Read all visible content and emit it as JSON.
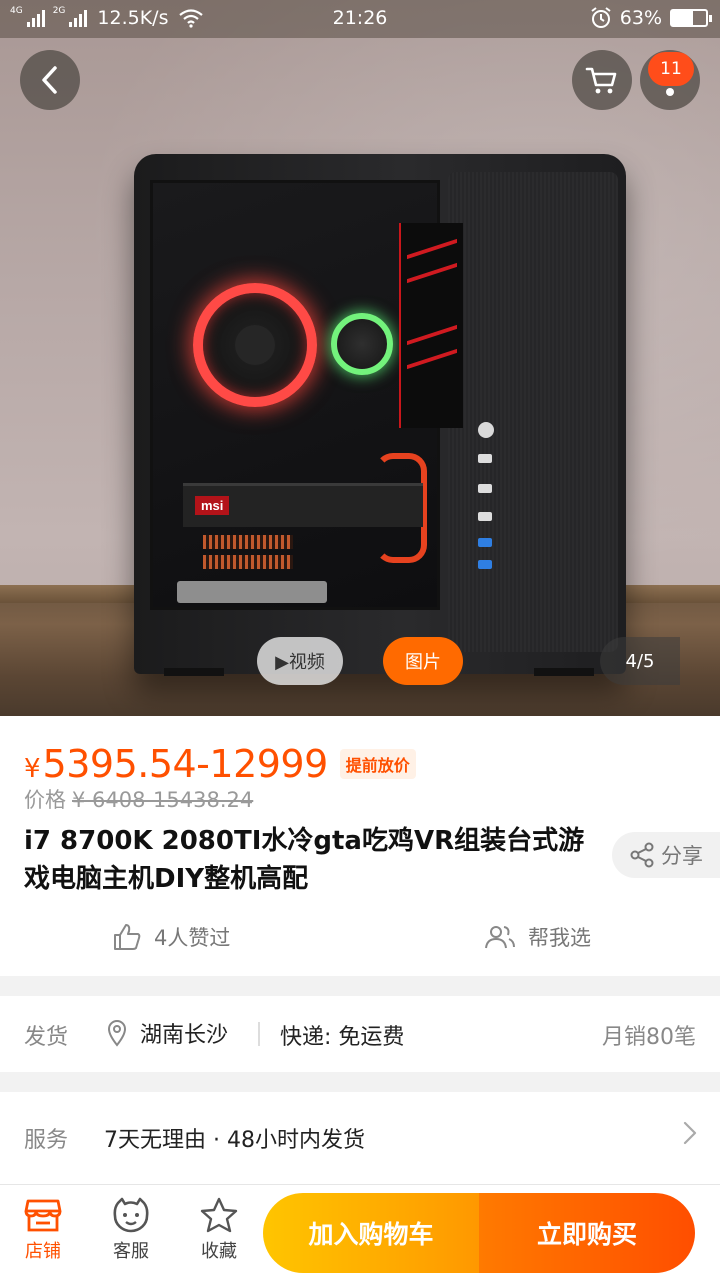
{
  "status_bar": {
    "net1": "4G",
    "net2": "2G",
    "net2_sup": "R",
    "speed": "12.5K/s",
    "time": "21:26",
    "battery": "63%",
    "battery_level": 0.63
  },
  "header": {
    "cart_badge": "11"
  },
  "gallery": {
    "video_label": "▶视频",
    "photo_label": "图片",
    "counter": "4/5",
    "gpu_brand": "msi"
  },
  "product": {
    "currency": "¥",
    "price": "5395.54-12999",
    "price_tag": "提前放价",
    "orig_label": "价格",
    "orig_price": "¥ 6408-15438.24",
    "title": "i7 8700K 2080TI水冷gta吃鸡VR组装台式游戏电脑主机DIY整机高配",
    "share_label": "分享",
    "likes_label": "4人赞过",
    "help_choose_label": "帮我选"
  },
  "shipping": {
    "label": "发货",
    "location": "湖南长沙",
    "express": "快递: 免运费",
    "monthly_sales": "月销80笔"
  },
  "service": {
    "label": "服务",
    "text": "7天无理由 · 48小时内发货"
  },
  "bottom_bar": {
    "store_label": "店铺",
    "service_label": "客服",
    "fav_label": "收藏",
    "add_cart_label": "加入购物车",
    "buy_now_label": "立即购买"
  },
  "colors": {
    "accent": "#ff5000",
    "cart_gradient_start": "#ffc500",
    "buy_gradient_end": "#ff4e00"
  }
}
